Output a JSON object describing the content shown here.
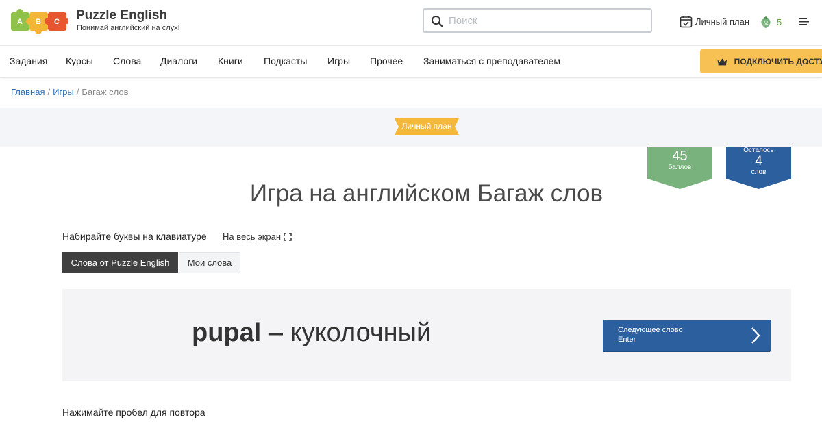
{
  "brand": {
    "logo_letters": [
      "A",
      "B",
      "C"
    ],
    "name": "Puzzle English",
    "tagline": "Понимай английский на слух!"
  },
  "search": {
    "placeholder": "Поиск",
    "value": ""
  },
  "header": {
    "plan_label": "Личный план",
    "points": "5",
    "icons": {
      "plan": "calendar-check-icon",
      "points": "strawberry-icon",
      "menu": "menu-icon",
      "search": "search-icon"
    }
  },
  "nav": {
    "items": [
      "Задания",
      "Курсы",
      "Слова",
      "Диалоги",
      "Книги",
      "Подкасты",
      "Игры",
      "Прочее",
      "Заниматься с преподавателем"
    ],
    "premium_label": "ПОДКЛЮЧИТЬ ДОСТУП"
  },
  "breadcrumb": [
    "Главная",
    "Игры",
    "Багаж слов"
  ],
  "plan_ribbon": "Личный план",
  "score": {
    "points_value": "45",
    "points_label": "баллов",
    "remaining_prefix": "Осталось",
    "remaining_value": "4",
    "remaining_label": "слов"
  },
  "page_title": "Игра на английском Багаж слов",
  "instructions": {
    "typing": "Набирайте буквы на клавиатуре",
    "fullscreen": "На весь экран"
  },
  "tabs": [
    "Слова от Puzzle English",
    "Мои слова"
  ],
  "game": {
    "word": "pupal",
    "dash": " – ",
    "translation": "куколочный",
    "next_label": "Следующее слово",
    "next_hint": "Enter"
  },
  "repeat_hint": "Нажимайте пробел для повтора",
  "colors": {
    "accent_blue": "#2c5f9e",
    "points_green": "#7ab27e",
    "premium_yellow": "#f8c153",
    "ribbon_yellow": "#f4b83b",
    "logo": [
      "#8fc14b",
      "#f2b535",
      "#e8562f"
    ]
  }
}
